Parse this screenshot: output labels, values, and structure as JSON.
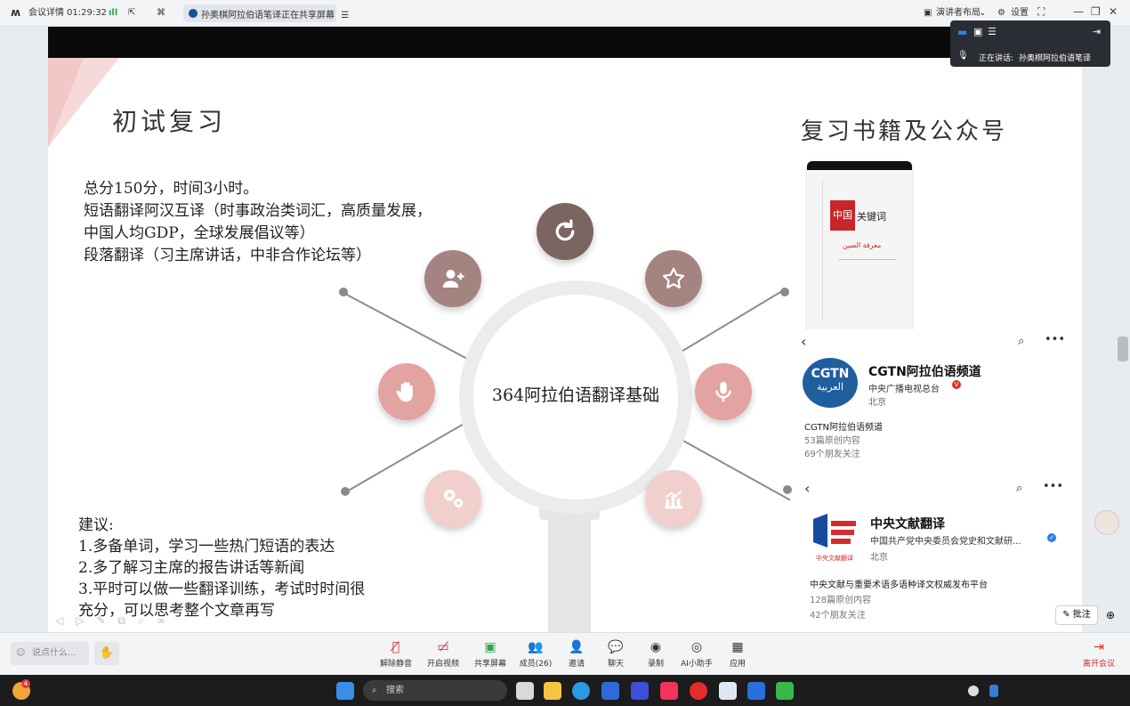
{
  "meeting": {
    "details_label": "会议详情",
    "timer": "01:29:32",
    "share_status": "孙奥棋阿拉伯语笔译正在共享屏幕",
    "presenter_layout": "演讲者布局",
    "settings": "设置",
    "speaking_label": "正在讲话:",
    "speaking_name": "孙奥棋阿拉伯语笔译"
  },
  "slide": {
    "left_title": "初试复习",
    "right_title": "复习书籍及公众号",
    "para_lines": [
      "总分150分，时间3小时。",
      "短语翻译阿汉互译（时事政治类词汇，高质量发展，",
      "中国人均GDP，全球发展倡议等）",
      "段落翻译（习主席讲话，中非合作论坛等）"
    ],
    "advice_lines": [
      "建议:",
      "1.多备单词，学习一些热门短语的表达",
      "2.多了解习主席的报告讲话等新闻",
      "3.平时可以做一些翻译训练，考试时时间很",
      "充分，可以思考整个文章再写"
    ],
    "center_text": "364阿拉伯语翻译基础",
    "icons": [
      "refresh-icon",
      "add-user-icon",
      "star-icon",
      "hand-icon",
      "microphone-icon",
      "gears-icon",
      "chart-icon"
    ],
    "colors": {
      "dark": "#7a6560",
      "mid": "#a38480",
      "pink": "#e3a3a0",
      "light": "#f1cfcd"
    },
    "book": {
      "red_text": "中国",
      "keyword": "关键词",
      "arabic": "معرفة الصين"
    }
  },
  "cards": {
    "cgtn": {
      "name": "CGTN阿拉伯语频道",
      "org": "中央广播电视总台",
      "location": "北京",
      "link": "CGTN阿拉伯语频道",
      "articles": "53篇原创内容",
      "followers": "69个朋友关注",
      "logo_text": "CGTN",
      "logo_sub": "العربية"
    },
    "zywx": {
      "name": "中央文献翻译",
      "org": "中国共产党中央委员会党史和文献研...",
      "location": "北京",
      "link": "中央文献与重要术语多语种译文权威发布平台",
      "articles": "128篇原创内容",
      "followers": "42个朋友关注",
      "logo_caption": "中央文献翻译"
    }
  },
  "side": {
    "annotate": "批注"
  },
  "toolbar": {
    "chat_placeholder": "说点什么...",
    "buttons": [
      "解除静音",
      "开启视频",
      "共享屏幕",
      "成员(26)",
      "邀请",
      "聊天",
      "录制",
      "AI小助手",
      "应用"
    ],
    "leave": "离开会议"
  },
  "taskbar": {
    "search": "搜索",
    "badge": "4"
  }
}
